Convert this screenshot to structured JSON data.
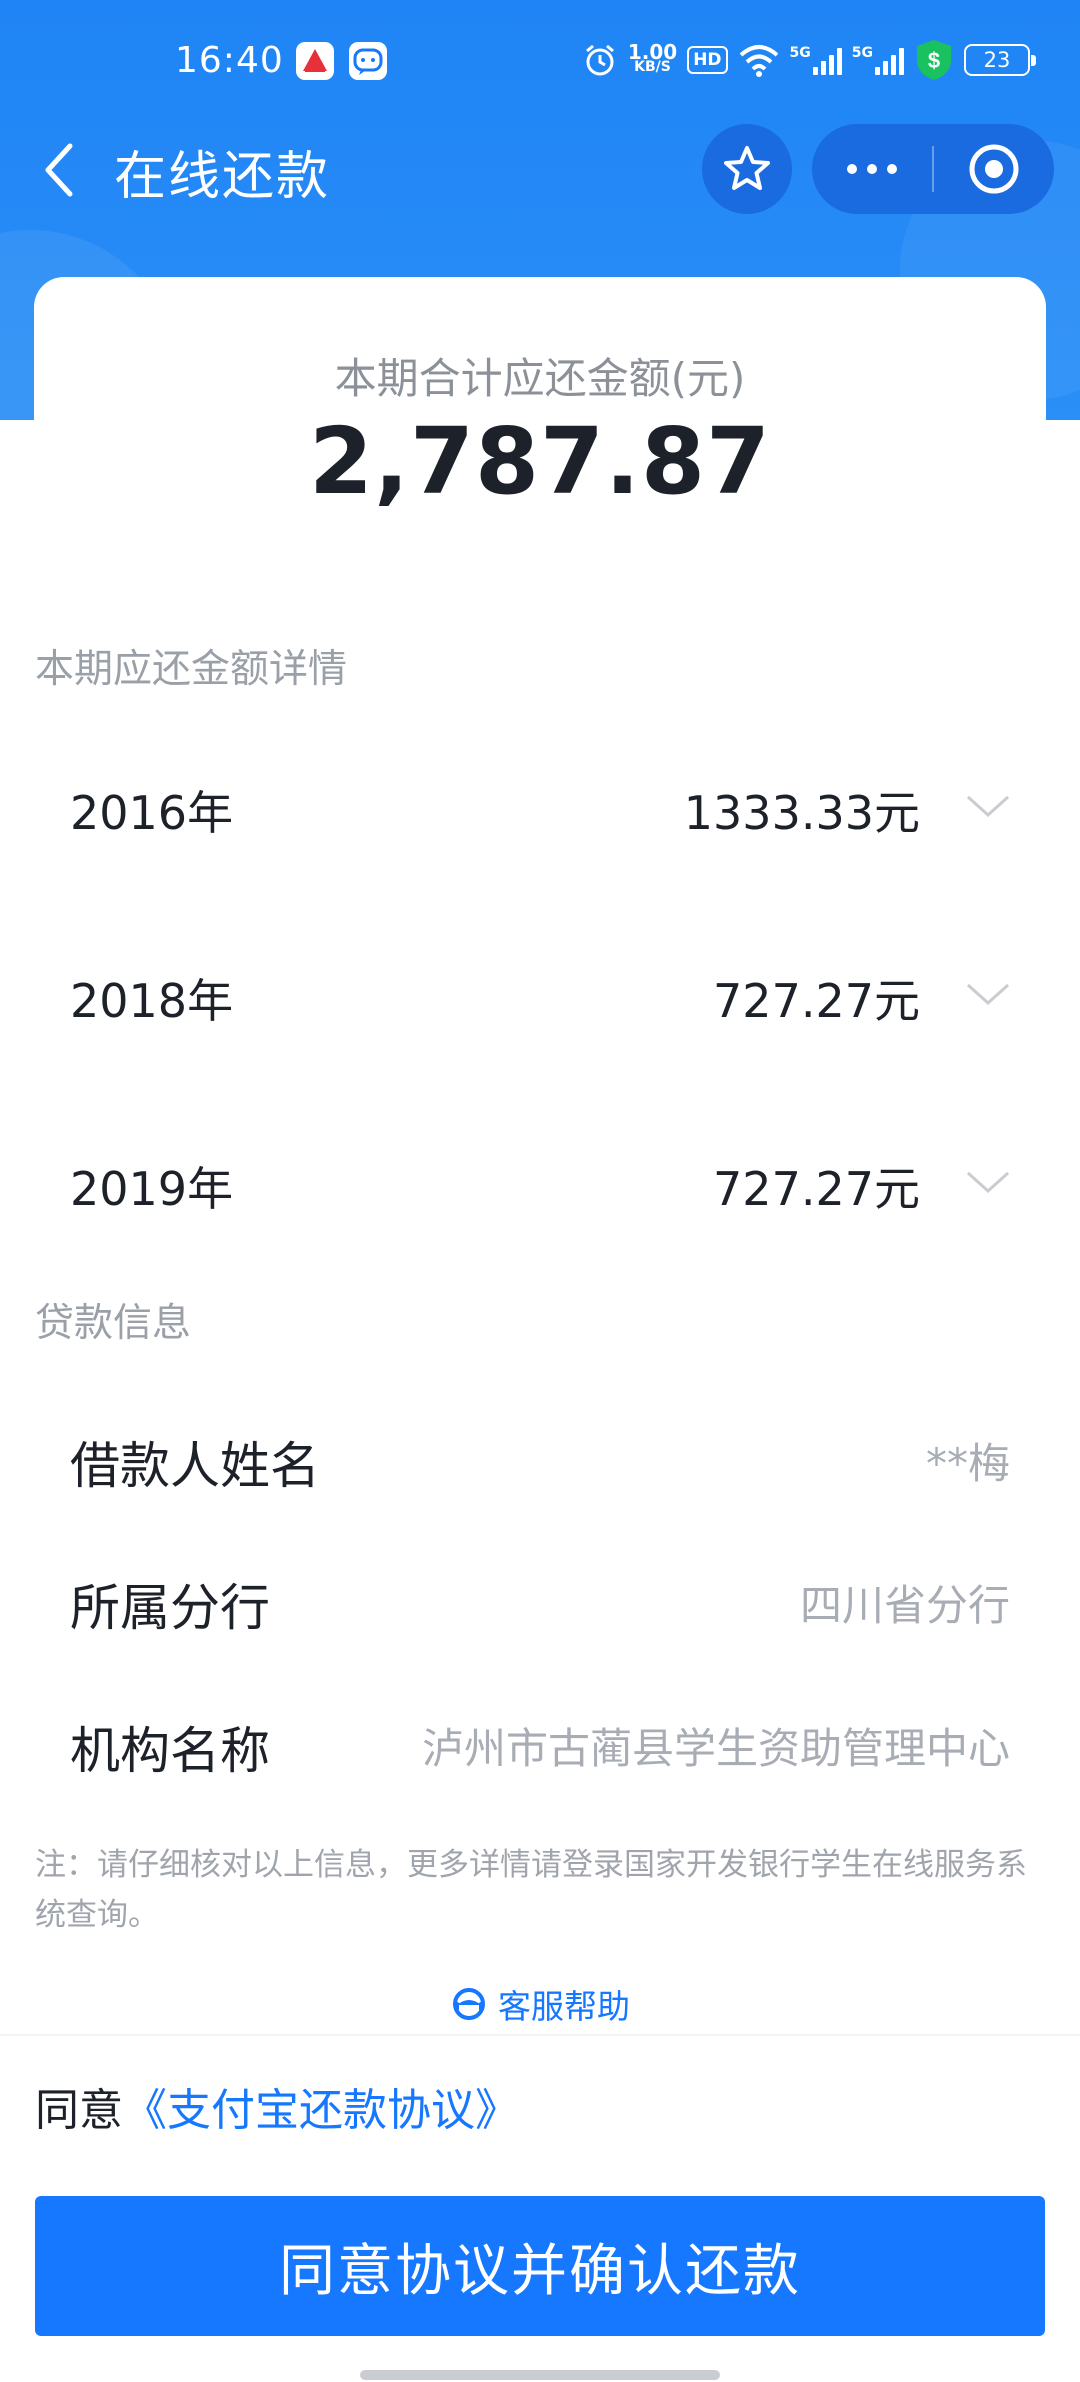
{
  "status_bar": {
    "time": "16:40",
    "speed_value": "1.00",
    "speed_unit": "KB/S",
    "hd_label": "HD",
    "net1": "5G",
    "net2": "5G",
    "battery": "23"
  },
  "nav": {
    "title": "在线还款",
    "back_icon": "chevron-left-icon",
    "favorite_icon": "star-icon",
    "more_icon": "more-dots-icon",
    "target_icon": "target-icon"
  },
  "summary": {
    "label": "本期合计应还金额(元)",
    "amount": "2,787.87"
  },
  "details": {
    "heading": "本期应还金额详情",
    "rows": [
      {
        "year": "2016年",
        "amount": "1333.33元"
      },
      {
        "year": "2018年",
        "amount": "727.27元"
      },
      {
        "year": "2019年",
        "amount": "727.27元"
      }
    ]
  },
  "loan_info": {
    "heading": "贷款信息",
    "rows": [
      {
        "label": "借款人姓名",
        "value": "**梅"
      },
      {
        "label": "所属分行",
        "value": "四川省分行"
      },
      {
        "label": "机构名称",
        "value": "泸州市古蔺县学生资助管理中心"
      }
    ]
  },
  "note": "注：请仔细核对以上信息，更多详情请登录国家开发银行学生在线服务系统查询。",
  "help_label": "客服帮助",
  "agreement": {
    "prefix": "同意",
    "link": "《支付宝还款协议》"
  },
  "confirm_label": "同意协议并确认还款",
  "colors": {
    "primary": "#1677ff",
    "header": "#1f84f5",
    "text": "#1d2129",
    "muted": "#a8adb5"
  }
}
